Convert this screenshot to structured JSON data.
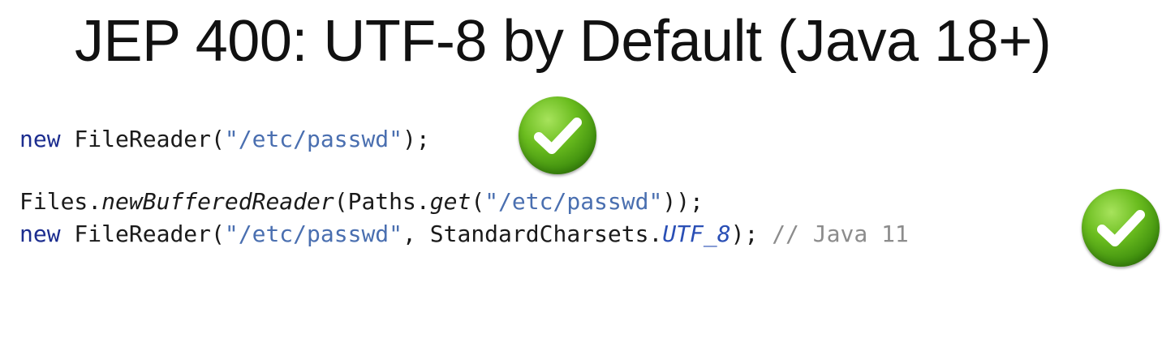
{
  "slide": {
    "title": "JEP 400: UTF-8 by Default (Java 18+)"
  },
  "code_line_1": {
    "kw_new": "new",
    "class": " FileReader(",
    "path": "\"/etc/passwd\"",
    "tail": ");"
  },
  "code_line_2": {
    "prefix": "Files.",
    "method": "newBufferedReader",
    "mid": "(Paths.",
    "get": "get",
    "open": "(",
    "path": "\"/etc/passwd\"",
    "tail": "));"
  },
  "code_line_3": {
    "kw_new": "new",
    "class": " FileReader(",
    "path": "\"/etc/passwd\"",
    "mid": ", StandardCharsets.",
    "constant": "UTF_8",
    "tail": "); ",
    "comment": "// Java 11"
  },
  "icons": {
    "check_1": "check-circle-icon",
    "check_2": "check-circle-icon"
  },
  "colors": {
    "keyword": "#1c2d8f",
    "string": "#4a6fb0",
    "comment": "#8c8c8c",
    "check_green": "#6bbd1f"
  }
}
